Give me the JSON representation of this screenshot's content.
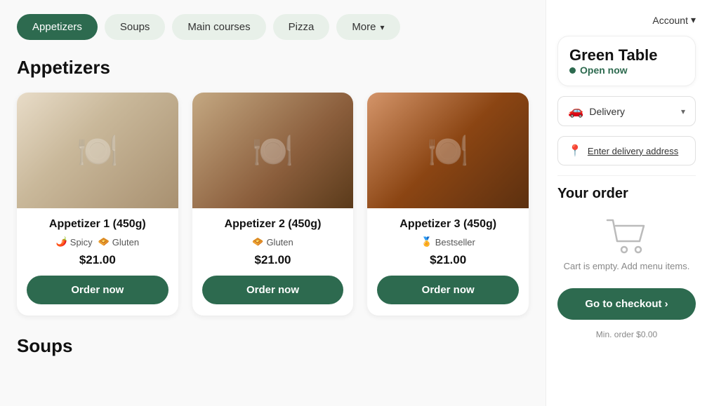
{
  "nav": {
    "tabs": [
      {
        "id": "appetizers",
        "label": "Appetizers",
        "active": true
      },
      {
        "id": "soups",
        "label": "Soups",
        "active": false
      },
      {
        "id": "main-courses",
        "label": "Main courses",
        "active": false
      },
      {
        "id": "pizza",
        "label": "Pizza",
        "active": false
      },
      {
        "id": "more",
        "label": "More",
        "active": false,
        "has_chevron": true
      }
    ]
  },
  "section": {
    "title": "Appetizers"
  },
  "cards": [
    {
      "name": "Appetizer 1 (450g)",
      "tags": [
        {
          "icon": "🌶️",
          "label": "Spicy"
        },
        {
          "icon": "🧇",
          "label": "Gluten"
        }
      ],
      "price": "$21.00",
      "order_label": "Order now",
      "img_class": "food-img-1"
    },
    {
      "name": "Appetizer 2 (450g)",
      "tags": [
        {
          "icon": "🧇",
          "label": "Gluten"
        }
      ],
      "price": "$21.00",
      "order_label": "Order now",
      "img_class": "food-img-2"
    },
    {
      "name": "Appetizer 3 (450g)",
      "tags": [
        {
          "icon": "🏅",
          "label": "Bestseller"
        }
      ],
      "price": "$21.00",
      "order_label": "Order now",
      "img_class": "food-img-3"
    }
  ],
  "soups_section": {
    "title": "Soups"
  },
  "sidebar": {
    "account_label": "Account",
    "account_chevron": "▾",
    "restaurant_name": "Green Table",
    "open_status": "Open now",
    "delivery_label": "Delivery",
    "address_placeholder": "Enter delivery address",
    "your_order_title": "Your order",
    "cart_empty_text": "Cart is empty. Add menu items.",
    "checkout_label": "Go to checkout ›",
    "min_order": "Min. order $0.00"
  }
}
